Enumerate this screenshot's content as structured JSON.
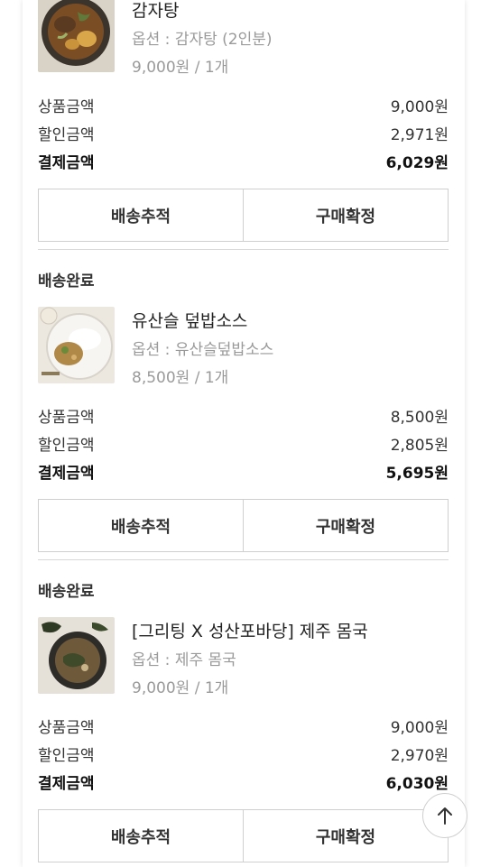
{
  "orders": [
    {
      "status": "",
      "product_name": "감자탕",
      "option": "옵션 : 감자탕 (2인분)",
      "price_qty": "9,000원 / 1개",
      "product_amount_label": "상품금액",
      "product_amount": "9,000원",
      "discount_label": "할인금액",
      "discount": "2,971원",
      "payment_label": "결제금액",
      "payment": "6,029원",
      "track_button": "배송추적",
      "confirm_button": "구매확정"
    },
    {
      "status": "배송완료",
      "product_name": "유산슬 덮밥소스",
      "option": "옵션 : 유산슬덮밥소스",
      "price_qty": "8,500원 / 1개",
      "product_amount_label": "상품금액",
      "product_amount": "8,500원",
      "discount_label": "할인금액",
      "discount": "2,805원",
      "payment_label": "결제금액",
      "payment": "5,695원",
      "track_button": "배송추적",
      "confirm_button": "구매확정"
    },
    {
      "status": "배송완료",
      "product_name": "[그리팅 X 성산포바당] 제주 몸국",
      "option": "옵션 : 제주 몸국",
      "price_qty": "9,000원 / 1개",
      "product_amount_label": "상품금액",
      "product_amount": "9,000원",
      "discount_label": "할인금액",
      "discount": "2,970원",
      "payment_label": "결제금액",
      "payment": "6,030원",
      "track_button": "배송추적",
      "confirm_button": "구매확정"
    }
  ],
  "scroll_top_icon": "arrow-up-icon"
}
